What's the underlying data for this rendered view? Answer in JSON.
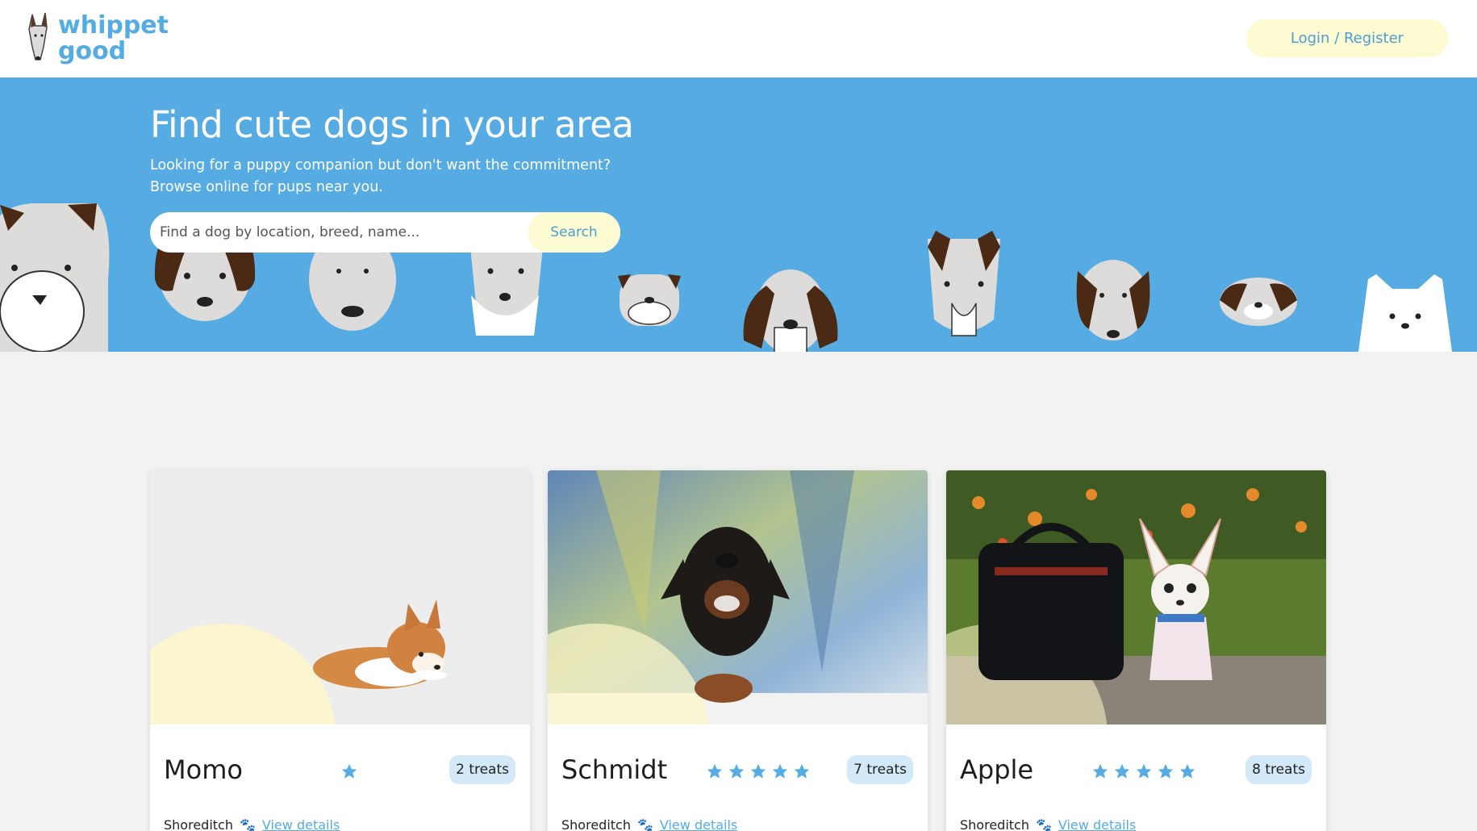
{
  "brand": {
    "line1": "whippet",
    "line2": "good",
    "logo_icon": "whippet-head-icon"
  },
  "header": {
    "login_label": "Login / Register"
  },
  "hero": {
    "title": "Find cute dogs in your area",
    "subtitle_line1": "Looking for a puppy companion but don't want the commitment?",
    "subtitle_line2": "Browse online for pups near you.",
    "search_placeholder": "Find a dog by location, breed, name...",
    "search_button": "Search"
  },
  "colors": {
    "brand_blue": "#56ace2",
    "cream": "#fdfbd2",
    "star_blue": "#55ace2"
  },
  "cards": [
    {
      "name": "Momo",
      "rating": 1,
      "treats": "2 treats",
      "location": "Shoreditch",
      "link": "View details"
    },
    {
      "name": "Schmidt",
      "rating": 5,
      "treats": "7 treats",
      "location": "Shoreditch",
      "link": "View details"
    },
    {
      "name": "Apple",
      "rating": 5,
      "treats": "8 treats",
      "location": "Shoreditch",
      "link": "View details"
    }
  ]
}
